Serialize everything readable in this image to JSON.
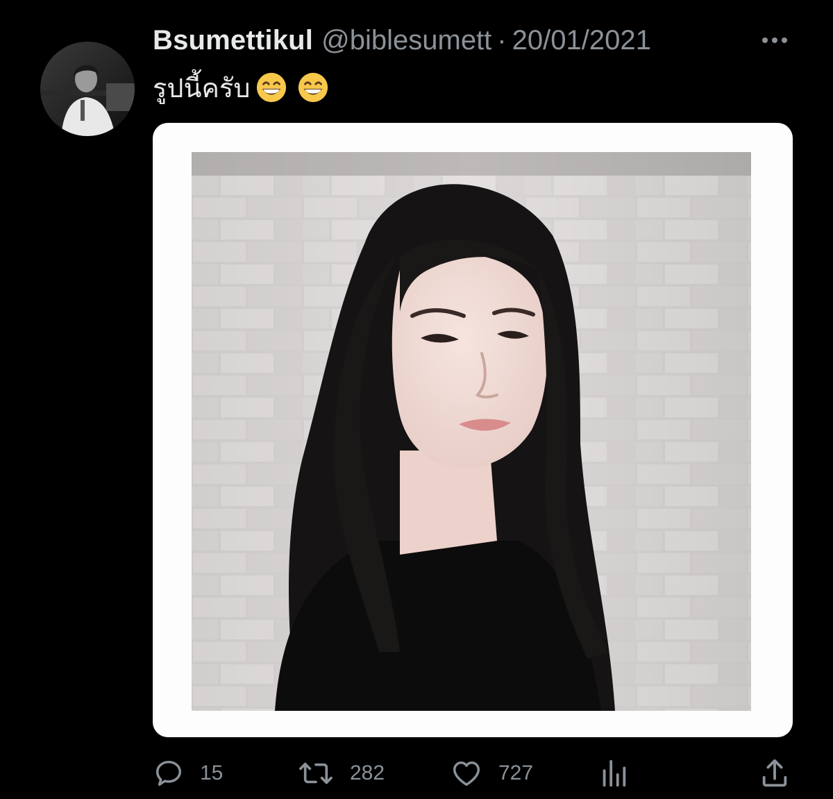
{
  "tweet": {
    "display_name": "Bsumettikul",
    "handle": "@biblesumett",
    "separator": "·",
    "date": "20/01/2021",
    "text": "รูปนี้ครับ",
    "emojis": [
      "grinning-face-with-smiling-eyes-emoji",
      "grinning-face-with-smiling-eyes-emoji"
    ]
  },
  "actions": {
    "reply_count": "15",
    "retweet_count": "282",
    "like_count": "727"
  },
  "icons": {
    "more": "more-options-icon",
    "reply": "reply-icon",
    "retweet": "retweet-icon",
    "like": "heart-icon",
    "views": "analytics-icon",
    "share": "share-icon"
  },
  "colors": {
    "background": "#000000",
    "primary_text": "#e7e9ea",
    "secondary_text": "#8b9299",
    "media_frame": "#fdfdfd"
  }
}
